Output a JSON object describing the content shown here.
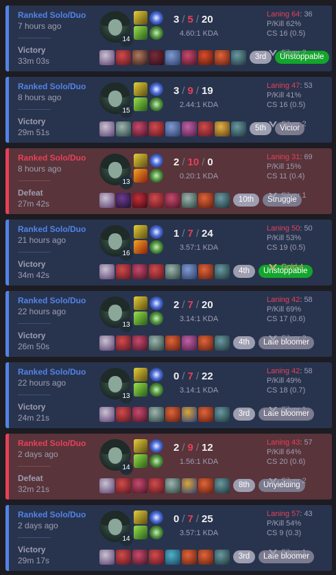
{
  "matches": [
    {
      "result_class": "win",
      "queue": "Ranked Solo/Duo",
      "time_ago": "7 hours ago",
      "result": "Victory",
      "duration": "33m 03s",
      "level": "14",
      "kills": "3",
      "deaths": "5",
      "assists": "20",
      "kda_ratio": "4.60:1 KDA",
      "spells": [
        "flash",
        "heal"
      ],
      "items": [
        [
          "#c9c3d2",
          "#5a3b6e"
        ],
        [
          "#d14b4b",
          "#5b1520"
        ],
        [
          "#b07b63",
          "#331812"
        ],
        [
          "#7a2b3c",
          "#2a0d14"
        ],
        [
          "#7f9bd1",
          "#2b3a66"
        ],
        [
          "#c84a6e",
          "#4a1222"
        ],
        [
          "#d94d2c",
          "#561708"
        ],
        [
          "#e0653a",
          "#611c0d"
        ],
        [
          "#6a9aa3",
          "#1b3236"
        ]
      ],
      "placement": "3rd",
      "tag": "Unstoppable",
      "tag_style": "green",
      "laning_label": "Laning 64",
      "laning_opp": ": 36",
      "pkill": "P/Kill 62%",
      "cs": "CS 16 (0.5)",
      "rank": "Silver 2",
      "rank_color": "#9e9eb1"
    },
    {
      "result_class": "win",
      "queue": "Ranked Solo/Duo",
      "time_ago": "8 hours ago",
      "result": "Victory",
      "duration": "29m 51s",
      "level": "15",
      "kills": "3",
      "deaths": "9",
      "assists": "19",
      "kda_ratio": "2.44:1 KDA",
      "spells": [
        "flash",
        "heal"
      ],
      "items": [
        [
          "#c9c3d2",
          "#5a3b6e"
        ],
        [
          "#9fb6b0",
          "#27403b"
        ],
        [
          "#c84a6e",
          "#4a1222"
        ],
        [
          "#d14b4b",
          "#5b1520"
        ],
        [
          "#7f9bd1",
          "#2b3a66"
        ],
        [
          "#c062a6",
          "#4d1a44"
        ],
        [
          "#d14b4b",
          "#5b1520"
        ],
        [
          "#e2b34a",
          "#5c3d0e"
        ],
        [
          "#6a9aa3",
          "#1b3236"
        ]
      ],
      "placement": "5th",
      "tag": "Victor",
      "tag_style": "gray",
      "laning_label": "Laning 47",
      "laning_opp": ": 53",
      "pkill": "P/Kill 41%",
      "cs": "CS 16 (0.5)",
      "rank": "Silver 2",
      "rank_color": "#9e9eb1"
    },
    {
      "result_class": "loss",
      "queue": "Ranked Solo/Duo",
      "time_ago": "8 hours ago",
      "result": "Defeat",
      "duration": "27m 42s",
      "level": "13",
      "kills": "2",
      "deaths": "10",
      "assists": "0",
      "kda_ratio": "0.20:1 KDA",
      "spells": [
        "flash",
        "ignite"
      ],
      "items": [
        [
          "#c9c3d2",
          "#5a3b6e"
        ],
        [
          "#6b3c8f",
          "#1f0f2e"
        ],
        [
          "#c62d3a",
          "#3d0a10"
        ],
        [
          "#d14b4b",
          "#5b1520"
        ],
        [
          "#c84a6e",
          "#4a1222"
        ],
        [
          "#9fb6b0",
          "#27403b"
        ],
        [
          "#e0653a",
          "#611c0d"
        ],
        [
          "#6a9aa3",
          "#1b3236"
        ]
      ],
      "placement": "10th",
      "tag": "Struggle",
      "tag_style": "gray",
      "laning_label": "Laning 31",
      "laning_opp": ": 69",
      "pkill": "P/Kill 15%",
      "cs": "CS 11 (0.4)",
      "rank": "Silver 1",
      "rank_color": "#9e9eb1"
    },
    {
      "result_class": "win",
      "queue": "Ranked Solo/Duo",
      "time_ago": "21 hours ago",
      "result": "Victory",
      "duration": "34m 42s",
      "level": "16",
      "kills": "1",
      "deaths": "7",
      "assists": "24",
      "kda_ratio": "3.57:1 KDA",
      "spells": [
        "flash",
        "ignite"
      ],
      "items": [
        [
          "#c9c3d2",
          "#5a3b6e"
        ],
        [
          "#d14b4b",
          "#5b1520"
        ],
        [
          "#c84a6e",
          "#4a1222"
        ],
        [
          "#d14b4b",
          "#5b1520"
        ],
        [
          "#9fb6b0",
          "#27403b"
        ],
        [
          "#7f9bd1",
          "#2b3a66"
        ],
        [
          "#e0653a",
          "#611c0d"
        ],
        [
          "#6a9aa3",
          "#1b3236"
        ]
      ],
      "placement": "4th",
      "tag": "Unstoppable",
      "tag_style": "green",
      "laning_label": "Laning 50",
      "laning_opp": ": 50",
      "pkill": "P/Kill 53%",
      "cs": "CS 19 (0.5)",
      "rank": "Gold 4",
      "rank_color": "#c8aa6e"
    },
    {
      "result_class": "win",
      "queue": "Ranked Solo/Duo",
      "time_ago": "22 hours ago",
      "result": "Victory",
      "duration": "26m 50s",
      "level": "13",
      "kills": "2",
      "deaths": "7",
      "assists": "20",
      "kda_ratio": "3.14:1 KDA",
      "spells": [
        "flash",
        "heal"
      ],
      "items": [
        [
          "#c9c3d2",
          "#5a3b6e"
        ],
        [
          "#d14b4b",
          "#5b1520"
        ],
        [
          "#c84a6e",
          "#4a1222"
        ],
        [
          "#9fb6b0",
          "#27403b"
        ],
        [
          "#e0653a",
          "#611c0d"
        ],
        [
          "#c062a6",
          "#4d1a44"
        ],
        [
          "#e0653a",
          "#611c0d"
        ],
        [
          "#6a9aa3",
          "#1b3236"
        ]
      ],
      "placement": "4th",
      "tag": "Late bloomer",
      "tag_style": "gray",
      "laning_label": "Laning 42",
      "laning_opp": ": 58",
      "pkill": "P/Kill 69%",
      "cs": "CS 17 (0.6)",
      "rank": "Silver 2",
      "rank_color": "#9e9eb1"
    },
    {
      "result_class": "win",
      "queue": "Ranked Solo/Duo",
      "time_ago": "22 hours ago",
      "result": "Victory",
      "duration": "24m 21s",
      "level": "13",
      "kills": "0",
      "deaths": "7",
      "assists": "22",
      "kda_ratio": "3.14:1 KDA",
      "spells": [
        "flash",
        "heal"
      ],
      "items": [
        [
          "#c9c3d2",
          "#5a3b6e"
        ],
        [
          "#d14b4b",
          "#5b1520"
        ],
        [
          "#c84a6e",
          "#4a1222"
        ],
        [
          "#9fb6b0",
          "#27403b"
        ],
        [
          "#e0653a",
          "#611c0d"
        ],
        [
          "#d9a63a",
          "#2a3a7a"
        ],
        [
          "#e0653a",
          "#611c0d"
        ],
        [
          "#6a9aa3",
          "#1b3236"
        ]
      ],
      "placement": "3rd",
      "tag": "Late bloomer",
      "tag_style": "gray",
      "laning_label": "Laning 42",
      "laning_opp": ": 58",
      "pkill": "P/Kill 49%",
      "cs": "CS 18 (0.7)",
      "rank": "Silver 1",
      "rank_color": "#9e9eb1"
    },
    {
      "result_class": "loss",
      "queue": "Ranked Solo/Duo",
      "time_ago": "2 days ago",
      "result": "Defeat",
      "duration": "32m 21s",
      "level": "14",
      "kills": "2",
      "deaths": "9",
      "assists": "12",
      "kda_ratio": "1.56:1 KDA",
      "spells": [
        "flash",
        "heal"
      ],
      "items": [
        [
          "#c9c3d2",
          "#5a3b6e"
        ],
        [
          "#d14b4b",
          "#5b1520"
        ],
        [
          "#c84a6e",
          "#4a1222"
        ],
        [
          "#d14b4b",
          "#5b1520"
        ],
        [
          "#9fb6b0",
          "#27403b"
        ],
        [
          "#d9a63a",
          "#2a3a7a"
        ],
        [
          "#e0653a",
          "#611c0d"
        ],
        [
          "#6a9aa3",
          "#1b3236"
        ]
      ],
      "placement": "8th",
      "tag": "Unyielding",
      "tag_style": "gray",
      "laning_label": "Laning 43",
      "laning_opp": ": 57",
      "pkill": "P/Kill 64%",
      "cs": "CS 20 (0.6)",
      "rank": "Silver 2",
      "rank_color": "#9e9eb1"
    },
    {
      "result_class": "win",
      "queue": "Ranked Solo/Duo",
      "time_ago": "2 days ago",
      "result": "Victory",
      "duration": "29m 17s",
      "level": "14",
      "kills": "0",
      "deaths": "7",
      "assists": "25",
      "kda_ratio": "3.57:1 KDA",
      "spells": [
        "flash",
        "heal"
      ],
      "items": [
        [
          "#c9c3d2",
          "#5a3b6e"
        ],
        [
          "#d14b4b",
          "#5b1520"
        ],
        [
          "#c84a6e",
          "#4a1222"
        ],
        [
          "#d14b4b",
          "#5b1520"
        ],
        [
          "#4fb3c9",
          "#1a3f5a"
        ],
        [
          "#e0653a",
          "#611c0d"
        ],
        [
          "#e0653a",
          "#611c0d"
        ],
        [
          "#6a9aa3",
          "#1b3236"
        ]
      ],
      "placement": "3rd",
      "tag": "Late bloomer",
      "tag_style": "gray",
      "laning_label": "Laning 57",
      "laning_opp": ": 43",
      "pkill": "P/Kill 54%",
      "cs": "CS 9 (0.3)",
      "rank": "Silver 1",
      "rank_color": "#9e9eb1"
    }
  ]
}
